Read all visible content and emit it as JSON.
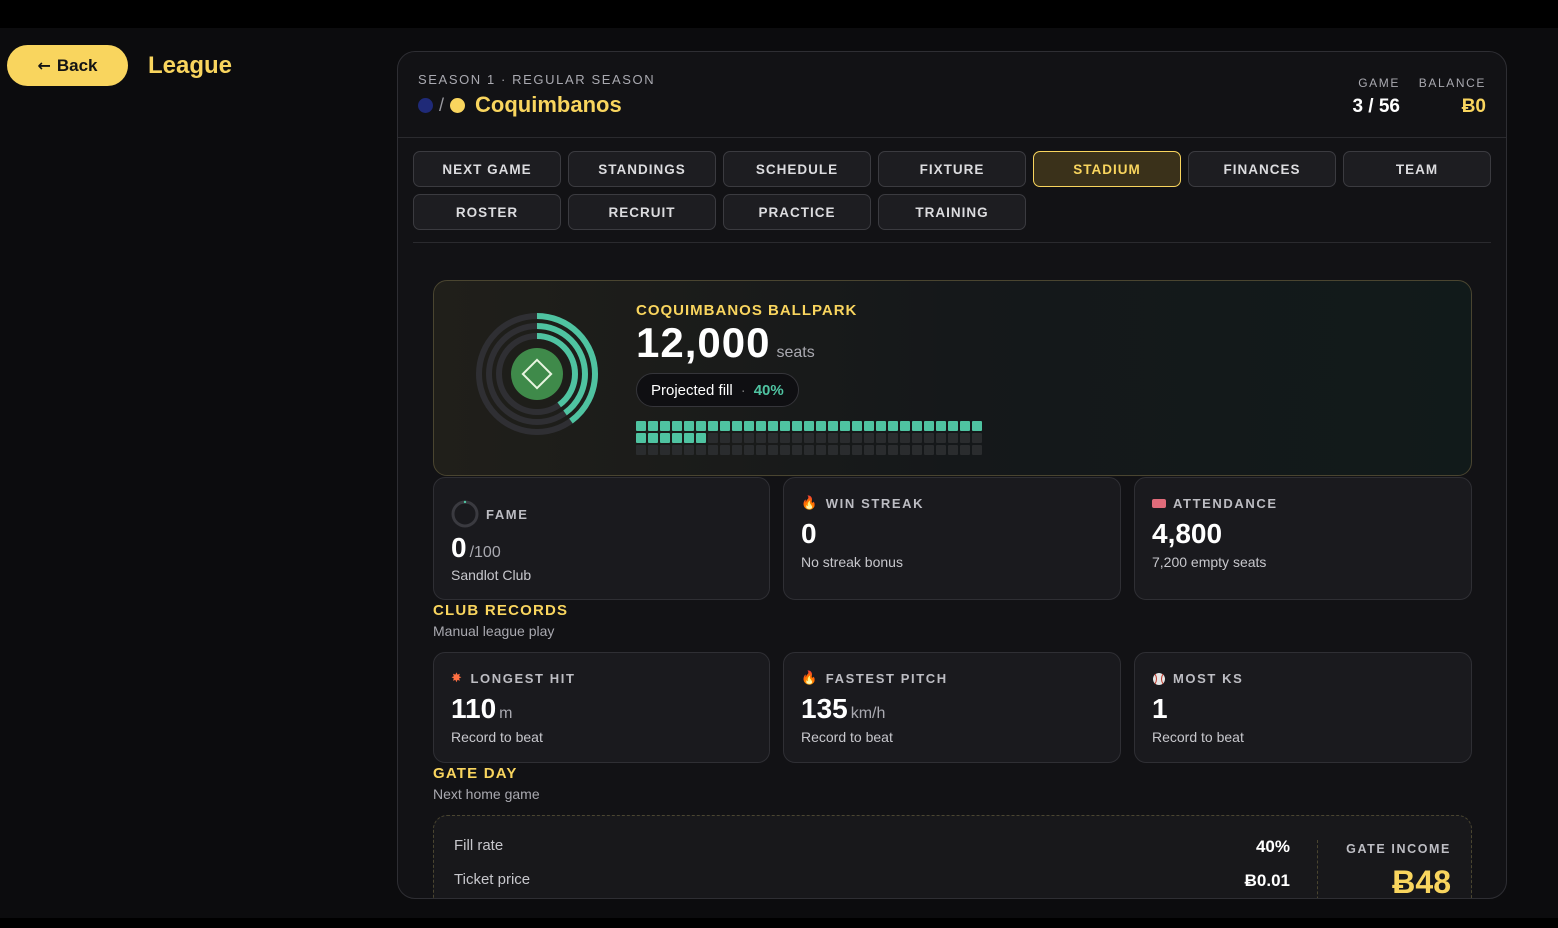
{
  "nav": {
    "back_label": "Back",
    "page_title": "League"
  },
  "header": {
    "season": "SEASON 1 · REGULAR SEASON",
    "team_name": "Coquimbanos",
    "team_colors": [
      "#1f2a78",
      "#f9d55e"
    ],
    "game_label": "GAME",
    "game_value": "3 / 56",
    "balance_label": "BALANCE",
    "balance_value": "Ƀ0"
  },
  "tabs": [
    {
      "label": "NEXT GAME",
      "active": false
    },
    {
      "label": "STANDINGS",
      "active": false
    },
    {
      "label": "SCHEDULE",
      "active": false
    },
    {
      "label": "FIXTURE",
      "active": false
    },
    {
      "label": "STADIUM",
      "active": true
    },
    {
      "label": "FINANCES",
      "active": false
    },
    {
      "label": "TEAM",
      "active": false
    },
    {
      "label": "ROSTER",
      "active": false
    },
    {
      "label": "RECRUIT",
      "active": false
    },
    {
      "label": "PRACTICE",
      "active": false
    },
    {
      "label": "TRAINING",
      "active": false
    }
  ],
  "stadium": {
    "name": "COQUIMBANOS BALLPARK",
    "seats": "12,000",
    "seats_unit": "seats",
    "projected_label": "Projected fill",
    "projected_pct": "40%",
    "fill_fraction": 0.4,
    "accent": "#4fc3a1"
  },
  "stats": {
    "fame": {
      "label": "FAME",
      "value": "0",
      "unit": "/100",
      "sub": "Sandlot Club",
      "icon": "fame-ring-icon"
    },
    "win_streak": {
      "label": "WIN STREAK",
      "value": "0",
      "sub": "No streak bonus",
      "icon": "fire-icon"
    },
    "attendance": {
      "label": "ATTENDANCE",
      "value": "4,800",
      "sub": "7,200 empty seats",
      "icon": "ticket-icon"
    }
  },
  "club_records": {
    "title": "CLUB RECORDS",
    "subtitle": "Manual league play",
    "longest_hit": {
      "label": "LONGEST HIT",
      "value": "110",
      "unit": "m",
      "sub": "Record to beat",
      "icon": "collision-icon"
    },
    "fastest_pitch": {
      "label": "FASTEST PITCH",
      "value": "135",
      "unit": "km/h",
      "sub": "Record to beat",
      "icon": "fire-icon"
    },
    "most_ks": {
      "label": "MOST KS",
      "value": "1",
      "sub": "Record to beat",
      "icon": "baseball-icon"
    }
  },
  "gate_day": {
    "title": "GATE DAY",
    "subtitle": "Next home game",
    "fill_rate_label": "Fill rate",
    "fill_rate_value": "40%",
    "ticket_price_label": "Ticket price",
    "ticket_price_value": "Ƀ0.01",
    "income_label": "GATE INCOME",
    "income_value": "Ƀ48"
  }
}
